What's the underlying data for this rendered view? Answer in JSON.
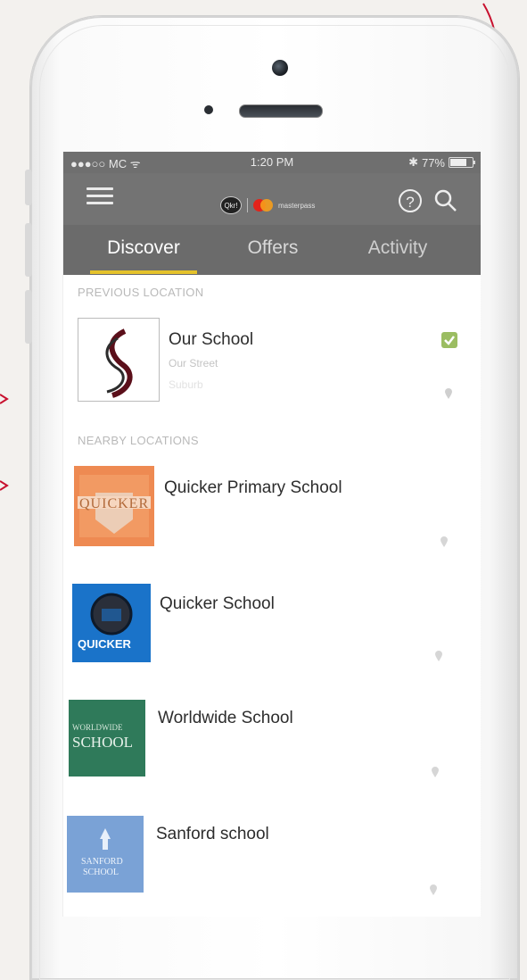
{
  "status_bar": {
    "carrier": "●●●○○ MC ᯤ",
    "time": "1:20 PM",
    "battery": "77%",
    "battery_level": 0.77
  },
  "nav": {
    "brand_qkr": "Qkr!",
    "brand_mp": "masterpass"
  },
  "tabs": [
    {
      "label": "Discover",
      "selected": true
    },
    {
      "label": "Offers",
      "selected": false
    },
    {
      "label": "Activity",
      "selected": false
    }
  ],
  "sections": {
    "previous": "PREVIOUS LOCATION",
    "nearby": "NEARBY LOCATIONS"
  },
  "previous_location": {
    "name": "Our School",
    "address": "Our Street",
    "suburb": "Suburb",
    "verified": true
  },
  "nearby_locations": [
    {
      "name": "Quicker Primary School",
      "logo_text": "QUICKER"
    },
    {
      "name": "Quicker School",
      "logo_text": "QUICKER"
    },
    {
      "name": "Worldwide School",
      "logo_text_1": "WORLDWIDE",
      "logo_text_2": "SCHOOL"
    },
    {
      "name": "Sanford school",
      "logo_text_1": "SANFORD",
      "logo_text_2": "SCHOOL"
    }
  ],
  "colors": {
    "tab_indicator": "#e4c22b",
    "header_bg": "#737373",
    "verified_check": "#9bbd62"
  }
}
